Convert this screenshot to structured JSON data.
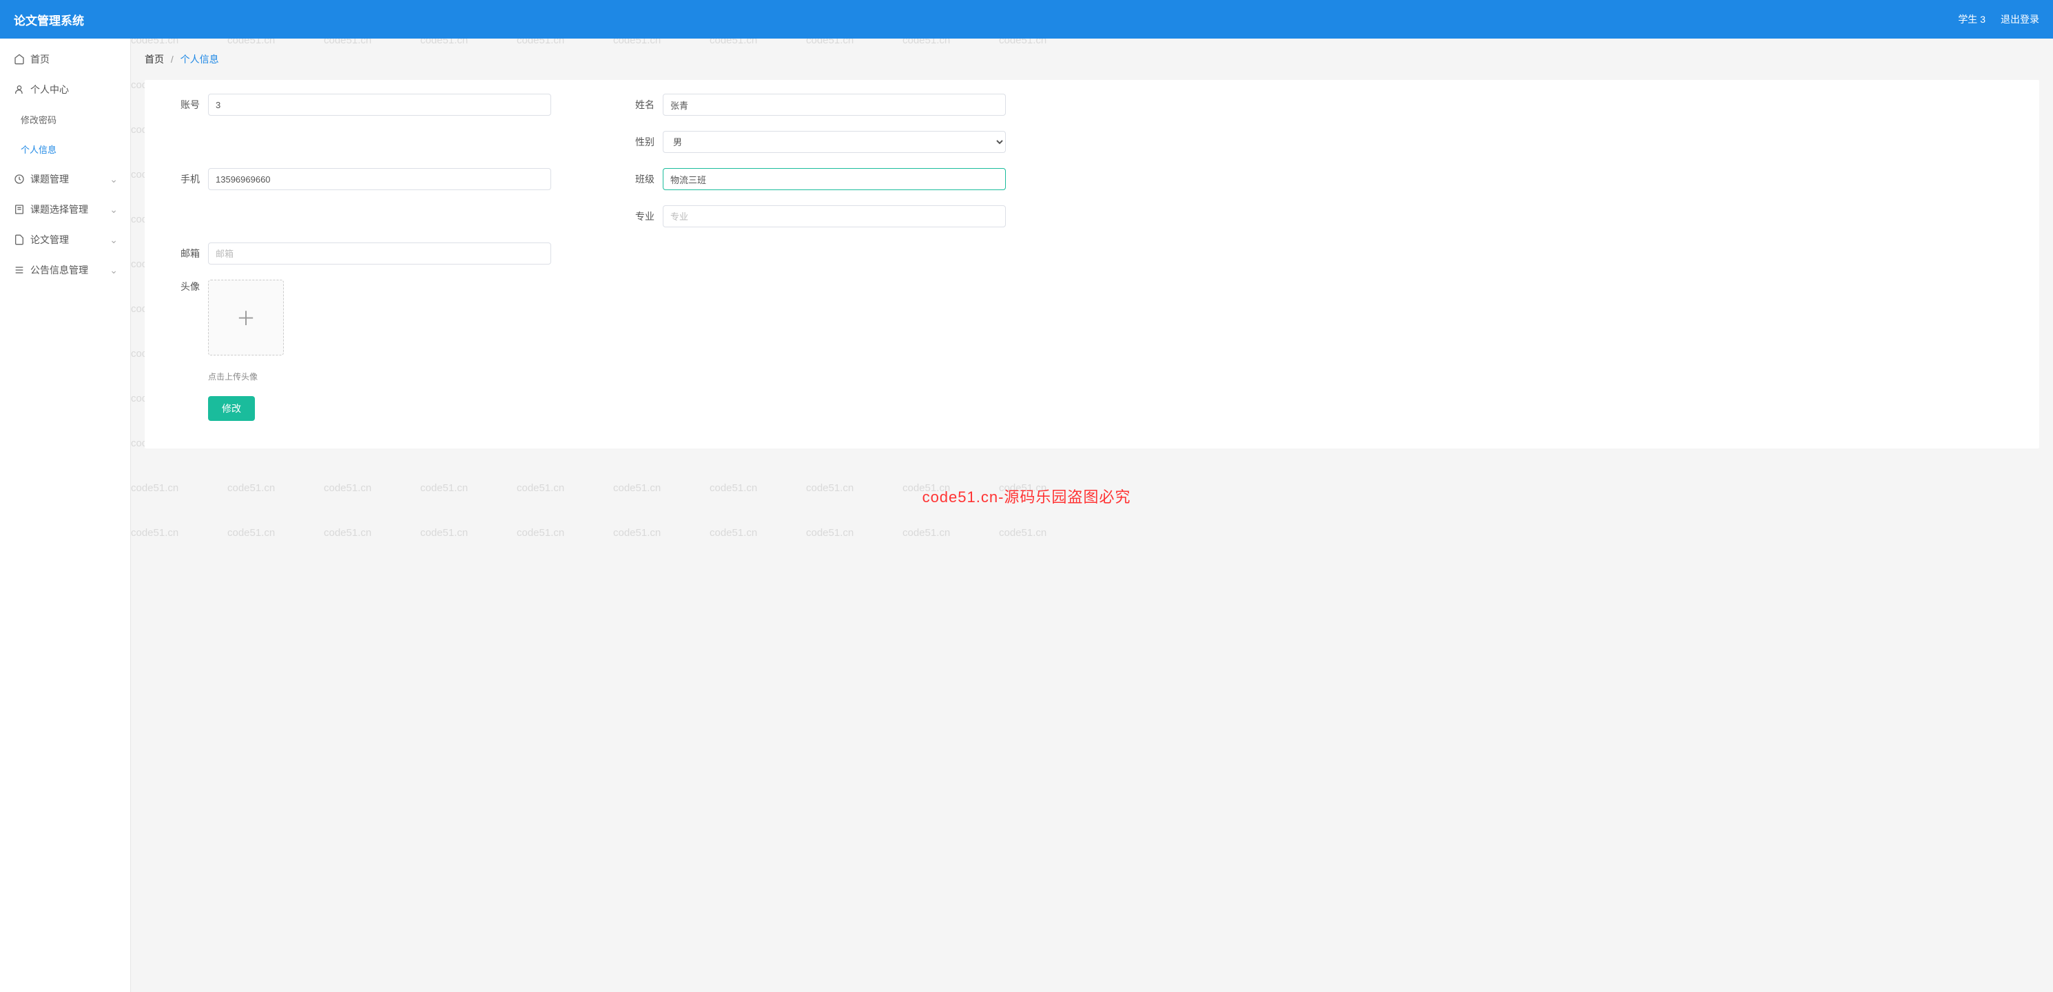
{
  "header": {
    "title": "论文管理系统",
    "user": "学生 3",
    "logout": "退出登录"
  },
  "sidebar": {
    "items": [
      {
        "label": "首页",
        "icon": "home-icon",
        "expandable": false
      },
      {
        "label": "个人中心",
        "icon": "user-icon",
        "expandable": true
      },
      {
        "label": "修改密码",
        "sub": true
      },
      {
        "label": "个人信息",
        "sub": true,
        "active": true
      },
      {
        "label": "课题管理",
        "icon": "clock-icon",
        "expandable": true
      },
      {
        "label": "课题选择管理",
        "icon": "book-icon",
        "expandable": true
      },
      {
        "label": "论文管理",
        "icon": "file-icon",
        "expandable": true
      },
      {
        "label": "公告信息管理",
        "icon": "list-icon",
        "expandable": true
      }
    ]
  },
  "breadcrumb": {
    "root": "首页",
    "current": "个人信息"
  },
  "form": {
    "account_label": "账号",
    "account_value": "3",
    "name_label": "姓名",
    "name_value": "张青",
    "gender_label": "性别",
    "gender_value": "男",
    "phone_label": "手机",
    "phone_value": "13596969660",
    "class_label": "班级",
    "class_value": "物流三班",
    "major_label": "专业",
    "major_placeholder": "专业",
    "email_label": "邮箱",
    "email_placeholder": "邮箱",
    "avatar_label": "头像",
    "avatar_hint": "点击上传头像",
    "submit_label": "修改"
  },
  "watermark": {
    "repeat_text": "code51.cn",
    "center_text": "code51.cn-源码乐园盗图必究"
  }
}
